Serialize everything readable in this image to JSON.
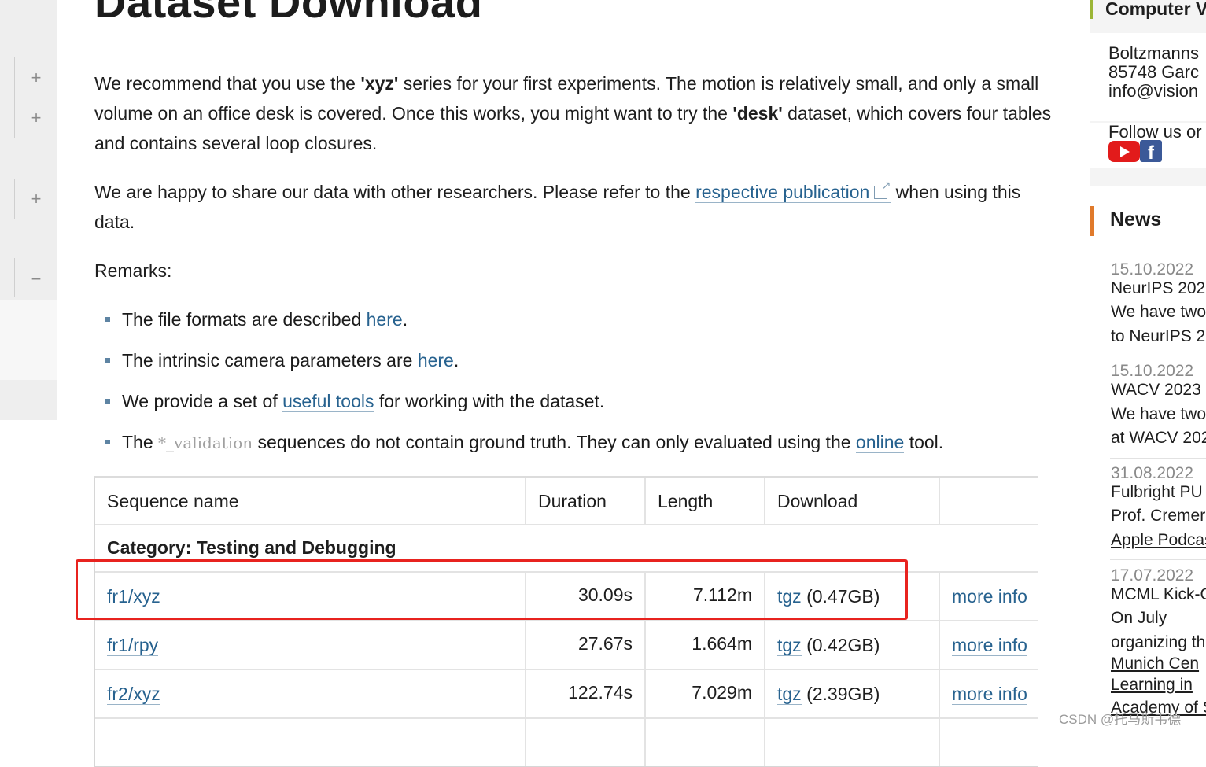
{
  "title": "Dataset Download",
  "intro": {
    "t1": "We recommend that you use the ",
    "b1": "'xyz'",
    "t2": " series for your first experiments. The motion is relatively small, and only a small volume on an office desk is covered. Once this works, you might want to try the ",
    "b2": "'desk'",
    "t3": " dataset, which covers four tables and contains several loop closures."
  },
  "share": {
    "t1": "We are happy to share our data with other researchers. Please refer to the ",
    "link": "respective publication",
    "t2": " when using this data."
  },
  "remarks_label": "Remarks:",
  "remarks": {
    "r1_pre": "The file formats are described ",
    "r1_link": "here",
    "r1_post": ".",
    "r2_pre": "The intrinsic camera parameters are ",
    "r2_link": "here",
    "r2_post": ".",
    "r3_pre": "We provide a set of ",
    "r3_link": "useful tools",
    "r3_post": " for working with the dataset.",
    "r4_pre": "The ",
    "r4_code": "*_validation",
    "r4_mid": " sequences do not contain ground truth. They can only evaluated using the ",
    "r4_link": "online",
    "r4_post": " tool."
  },
  "table": {
    "headers": [
      "Sequence name",
      "Duration",
      "Length",
      "Download",
      ""
    ],
    "category": "Category: Testing and Debugging",
    "rows": [
      {
        "name": "fr1/xyz",
        "duration": "30.09s",
        "length": "7.112m",
        "download": "tgz",
        "size": "(0.47GB)",
        "info": "more info"
      },
      {
        "name": "fr1/rpy",
        "duration": "27.67s",
        "length": "1.664m",
        "download": "tgz",
        "size": "(0.42GB)",
        "info": "more info"
      },
      {
        "name": "fr2/xyz",
        "duration": "122.74s",
        "length": "7.029m",
        "download": "tgz",
        "size": "(2.39GB)",
        "info": "more info"
      }
    ]
  },
  "gutter": {
    "plus": "+",
    "minus": "−"
  },
  "sidebar": {
    "title": "Computer V",
    "address": [
      "Boltzmanns",
      "85748 Garc",
      "info@vision"
    ],
    "follow": "Follow us or",
    "facebook_glyph": "f",
    "news_title": "News",
    "news": [
      {
        "date": "15.10.2022",
        "head": "NeurIPS 202",
        "l1": "We  have  two",
        "l2": "to NeurIPS 2"
      },
      {
        "date": "15.10.2022",
        "head": "WACV 2023",
        "l1": "We  have  two",
        "l2": "at WACV 202"
      },
      {
        "date": "31.08.2022",
        "head": "Fulbright   PU",
        "l1": "Prof.   Cremer",
        "l2": "Apple Podcas"
      },
      {
        "date": "17.07.2022",
        "head": "MCML Kick-O",
        "l1": "On      July",
        "l2": "organizing   th",
        "l3": "Munich    Cen",
        "l4": "Learning     in",
        "l5": "Academy of S"
      }
    ]
  },
  "watermark": "CSDN @托马斯韦德",
  "colors": {
    "link": "#27628f",
    "highlight": "#e8231f",
    "news_accent": "#e07a2b",
    "title_accent": "#9bb536"
  }
}
